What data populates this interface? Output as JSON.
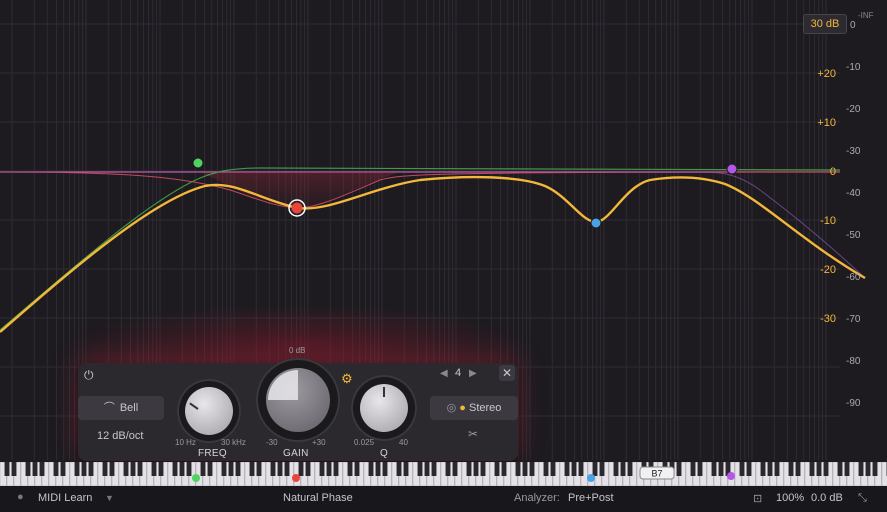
{
  "display": {
    "range_button": "30 dB",
    "inf_label": "-INF",
    "right_scale": [
      "0",
      "-10",
      "-20",
      "-30",
      "-40",
      "-50",
      "-60",
      "-70",
      "-80",
      "-90"
    ],
    "gain_scale": [
      "+20",
      "+10",
      "0",
      "-10",
      "-20",
      "-30"
    ]
  },
  "panel": {
    "shape_label": "Bell",
    "slope_label": "12 dB/oct",
    "band_number": "4",
    "freq": {
      "label": "FREQ",
      "min": "10 Hz",
      "max": "30 kHz"
    },
    "gain": {
      "label": "GAIN",
      "min": "-30",
      "max": "+30",
      "top": "0 dB"
    },
    "q": {
      "label": "Q",
      "min": "0.025",
      "max": "40"
    },
    "stereo_label": "Stereo"
  },
  "keyboard": {
    "note_badge": "B7"
  },
  "status": {
    "midi_learn": "MIDI Learn",
    "phase_mode": "Natural Phase",
    "analyzer_label": "Analyzer:",
    "analyzer_value": "Pre+Post",
    "zoom": "100%",
    "output_gain": "0.0 dB"
  },
  "colors": {
    "accent": "#f2b73b",
    "band_green": "#4fd460",
    "band_red": "#e8453c",
    "band_blue": "#4aa2e6",
    "band_purple": "#b556e6"
  }
}
